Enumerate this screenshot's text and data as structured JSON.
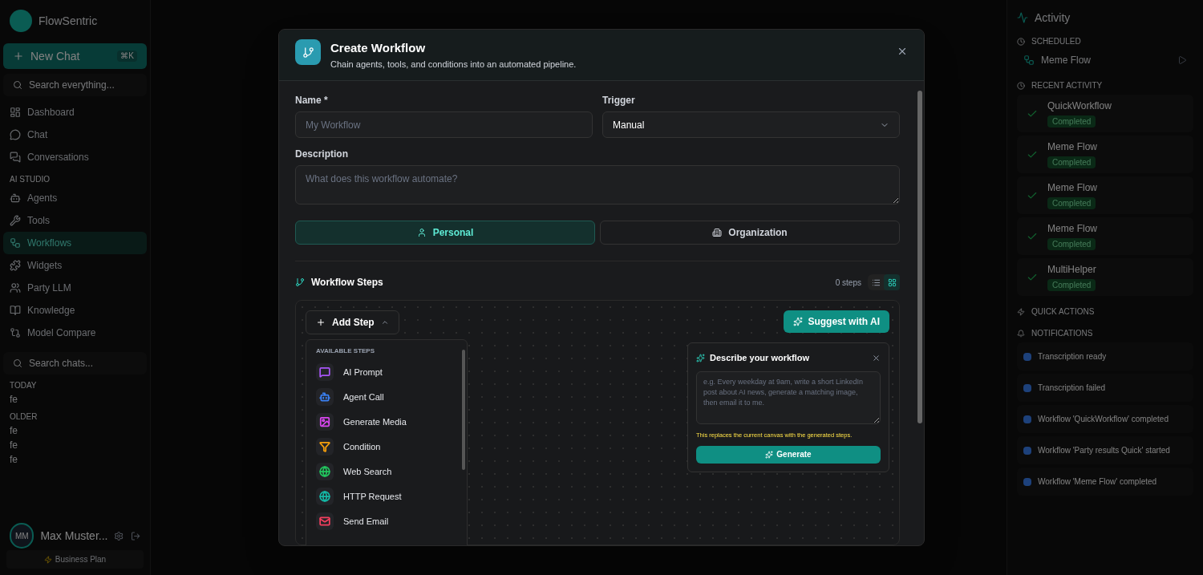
{
  "sidebar": {
    "brand": "FlowSentric",
    "new_chat": {
      "label": "New Chat",
      "shortcut": "⌘K"
    },
    "search": {
      "placeholder": "Search everything..."
    },
    "nav": [
      {
        "label": "Dashboard",
        "selected": false
      },
      {
        "label": "Chat",
        "selected": false
      },
      {
        "label": "Conversations",
        "selected": false
      }
    ],
    "studio_heading": "AI STUDIO",
    "studio": [
      {
        "label": "Agents",
        "selected": false
      },
      {
        "label": "Tools",
        "selected": false
      },
      {
        "label": "Workflows",
        "selected": true
      },
      {
        "label": "Widgets",
        "selected": false
      },
      {
        "label": "Party LLM",
        "selected": false
      },
      {
        "label": "Knowledge",
        "selected": false
      },
      {
        "label": "Model Compare",
        "selected": false
      }
    ],
    "chat_search": {
      "placeholder": "Search chats..."
    },
    "chat_groups": [
      {
        "heading": "TODAY",
        "items": [
          "fe"
        ]
      },
      {
        "heading": "OLDER",
        "items": [
          "fe",
          "fe",
          "fe"
        ]
      }
    ],
    "user": {
      "name": "Max Muster...",
      "initials": "MM"
    },
    "plan": "Business Plan"
  },
  "activity": {
    "title": "Activity",
    "scheduled_heading": "SCHEDULED",
    "scheduled": [
      "Meme Flow"
    ],
    "recent_heading": "RECENT ACTIVITY",
    "recent": [
      {
        "name": "QuickWorkflow",
        "status": "Completed"
      },
      {
        "name": "Meme Flow",
        "status": "Completed"
      },
      {
        "name": "Meme Flow",
        "status": "Completed"
      },
      {
        "name": "Meme Flow",
        "status": "Completed"
      },
      {
        "name": "MultiHelper",
        "status": "Completed"
      }
    ],
    "quick_actions_heading": "QUICK ACTIONS",
    "notifications_heading": "NOTIFICATIONS",
    "notifications": [
      {
        "title": "Transcription ready"
      },
      {
        "title": "Transcription failed"
      },
      {
        "title": "Workflow 'QuickWorkflow' completed"
      },
      {
        "title": "Workflow 'Party results Quick' started"
      },
      {
        "title": "Workflow 'Meme Flow' completed"
      }
    ]
  },
  "dialog": {
    "title": "Create Workflow",
    "subtitle": "Chain agents, tools, and conditions into an automated pipeline.",
    "name": {
      "label": "Name *",
      "placeholder": "My Workflow"
    },
    "trigger": {
      "label": "Trigger",
      "value": "Manual"
    },
    "description": {
      "label": "Description",
      "placeholder": "What does this workflow automate?"
    },
    "scope": [
      {
        "label": "Personal",
        "selected": true
      },
      {
        "label": "Organization",
        "selected": false
      }
    ],
    "steps_title": "Workflow Steps",
    "steps_count": "0 steps",
    "view_modes": [
      {
        "selected": false
      },
      {
        "selected": true
      }
    ],
    "add_step": "Add Step",
    "available_heading": "AVAILABLE STEPS",
    "available_steps": [
      {
        "label": "AI Prompt",
        "color": "#a855f7"
      },
      {
        "label": "Agent Call",
        "color": "#3b82f6"
      },
      {
        "label": "Generate Media",
        "color": "#d946ef"
      },
      {
        "label": "Condition",
        "color": "#f59e0b"
      },
      {
        "label": "Web Search",
        "color": "#22c55e"
      },
      {
        "label": "HTTP Request",
        "color": "#14b8a6"
      },
      {
        "label": "Send Email",
        "color": "#f43f5e"
      }
    ],
    "suggest_button": "Suggest with AI",
    "describe": {
      "title": "Describe your workflow",
      "placeholder": "e.g. Every weekday at 9am, write a short LinkedIn post about AI news, generate a matching image, then email it to me.",
      "warning": "This replaces the current canvas with the generated steps.",
      "button": "Generate"
    }
  }
}
